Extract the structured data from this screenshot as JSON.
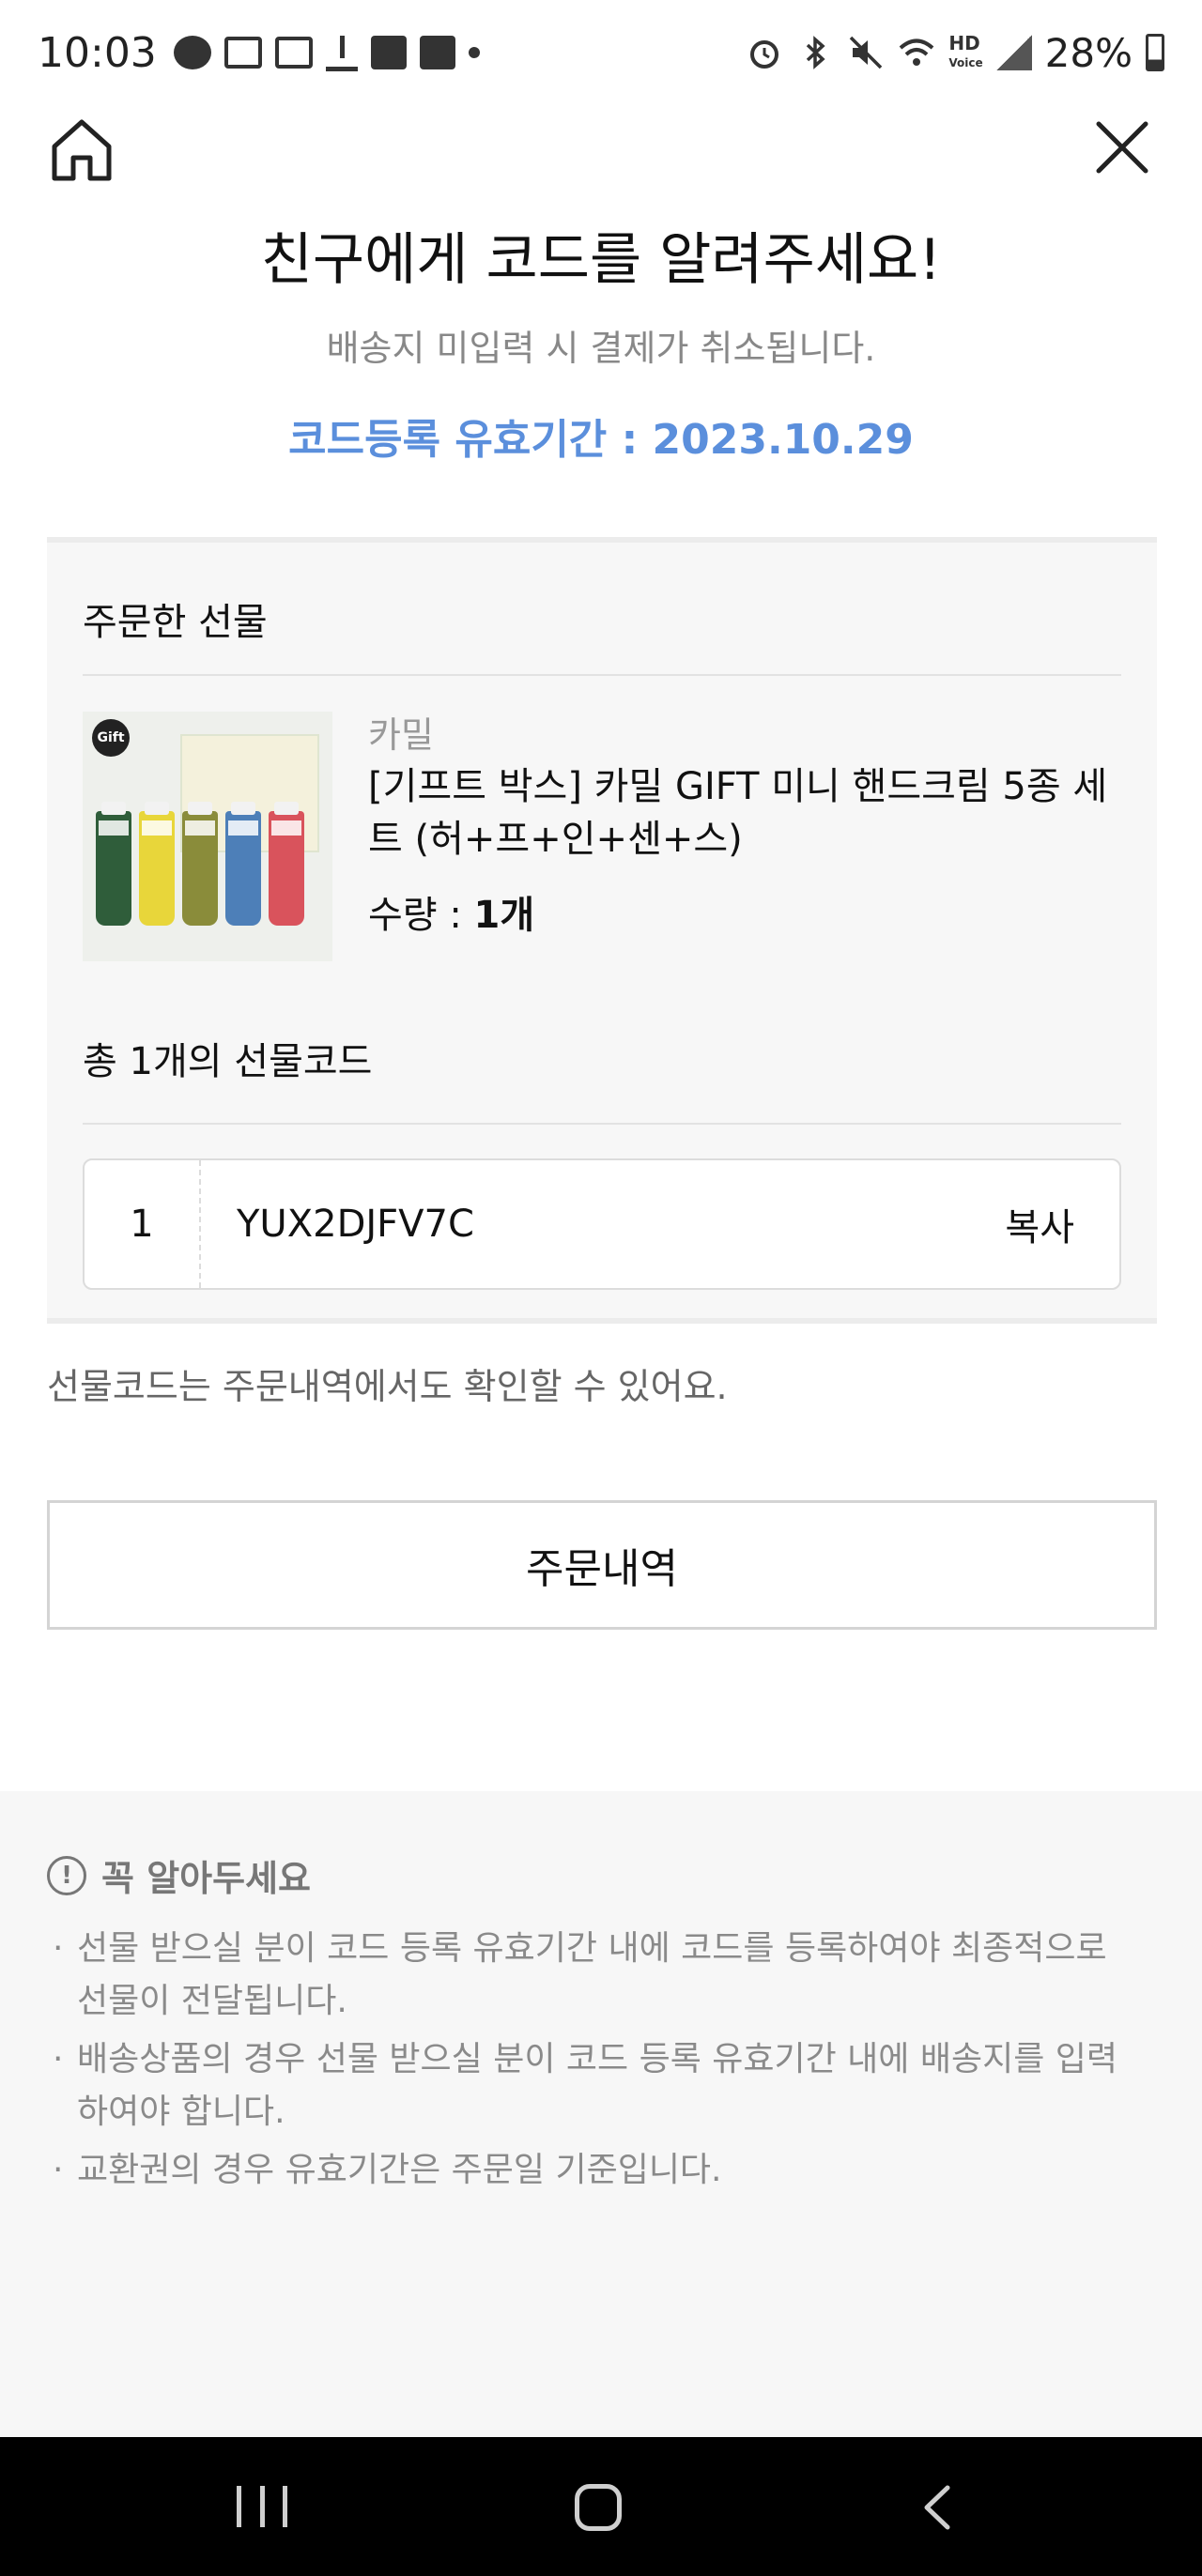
{
  "status_bar": {
    "time": "10:03",
    "battery": "28%",
    "hd_label": "HD",
    "voice_label": "Voice"
  },
  "header": {
    "home_icon": "home-icon",
    "close_icon": "close-icon"
  },
  "title": "친구에게 코드를 알려주세요!",
  "subtitle": "배송지 미입력 시 결제가 취소됩니다.",
  "validity": "코드등록 유효기간 : 2023.10.29",
  "gift_section": {
    "title": "주문한 선물",
    "product": {
      "badge": "Gift",
      "brand": "카밀",
      "name": "[기프트 박스] 카밀 GIFT 미니 핸드크림 5종 세트 (허+프+인+센+스)",
      "qty_label": "수량 : ",
      "qty_value": "1개"
    },
    "code_count_label": "총 1개의 선물코드",
    "codes": [
      {
        "index": "1",
        "code": "YUX2DJFV7C",
        "copy_label": "복사"
      }
    ]
  },
  "note": "선물코드는 주문내역에서도 확인할 수 있어요.",
  "order_history_button": "주문내역",
  "notice": {
    "title": "꼭 알아두세요",
    "items": [
      "선물 받으실 분이 코드 등록 유효기간 내에 코드를 등록하여야 최종적으로 선물이 전달됩니다.",
      "배송상품의 경우 선물 받으실 분이 코드 등록 유효기간 내에 배송지를 입력하여야 합니다.",
      "교환권의 경우 유효기간은 주문일 기준입니다."
    ]
  },
  "colors": {
    "accent_blue": "#5b8fdc",
    "panel_bg": "#f7f7f7",
    "nav_bg": "#000000"
  }
}
